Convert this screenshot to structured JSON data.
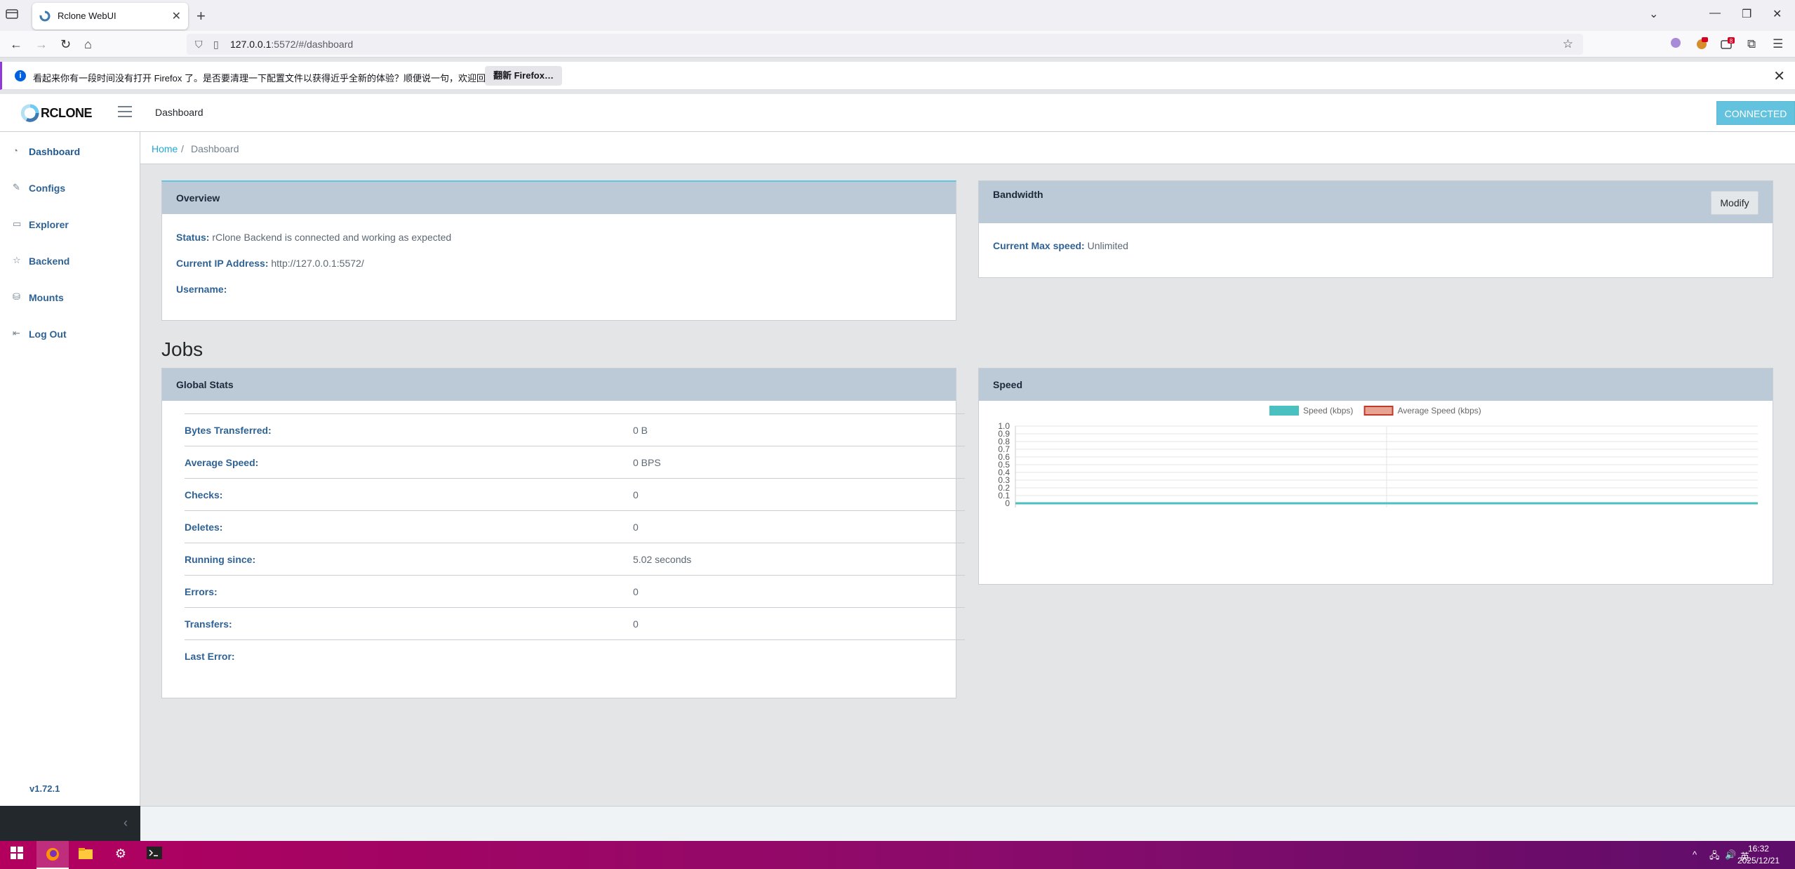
{
  "browser": {
    "tab_title": "Rclone WebUI",
    "url_host": "127.0.0.1",
    "url_rest": ":5572/#/dashboard",
    "notification_text": "看起来你有一段时间没有打开 Firefox 了。是否要清理一下配置文件以获得近乎全新的体验？顺便说一句，欢迎回来！",
    "notification_button": "翻新 Firefox…",
    "extension_badge": "8"
  },
  "header": {
    "logo_text": "RCLONE",
    "nav_dashboard": "Dashboard",
    "connected_label": "CONNECTED"
  },
  "sidebar": {
    "items": [
      {
        "label": "Dashboard",
        "icon": "speedometer-icon"
      },
      {
        "label": "Configs",
        "icon": "pencil-square-icon"
      },
      {
        "label": "Explorer",
        "icon": "monitor-icon"
      },
      {
        "label": "Backend",
        "icon": "star-icon"
      },
      {
        "label": "Mounts",
        "icon": "drive-icon"
      },
      {
        "label": "Log Out",
        "icon": "logout-icon"
      }
    ],
    "version": "v1.72.1"
  },
  "breadcrumb": {
    "home": "Home",
    "separator": "/",
    "current": "Dashboard"
  },
  "overview": {
    "title": "Overview",
    "status_label": "Status:",
    "status_value": "rClone Backend is connected and working as expected",
    "ip_label": "Current IP Address:",
    "ip_value": "http://127.0.0.1:5572/",
    "username_label": "Username:",
    "username_value": ""
  },
  "bandwidth": {
    "title": "Bandwidth",
    "modify_label": "Modify",
    "max_speed_label": "Current Max speed:",
    "max_speed_value": "Unlimited"
  },
  "jobs": {
    "title": "Jobs",
    "global_stats": {
      "title": "Global Stats",
      "rows": [
        {
          "key": "Bytes Transferred:",
          "value": "0 B"
        },
        {
          "key": "Average Speed:",
          "value": "0 BPS"
        },
        {
          "key": "Checks:",
          "value": "0"
        },
        {
          "key": "Deletes:",
          "value": "0"
        },
        {
          "key": "Running since:",
          "value": "5.02 seconds"
        },
        {
          "key": "Errors:",
          "value": "0"
        },
        {
          "key": "Transfers:",
          "value": "0"
        },
        {
          "key": "Last Error:",
          "value": ""
        }
      ]
    },
    "speed": {
      "title": "Speed"
    }
  },
  "chart_data": {
    "type": "line",
    "title": "",
    "xlabel": "",
    "ylabel": "",
    "ylim": [
      0,
      1.0
    ],
    "yticks": [
      "1.0",
      "0.9",
      "0.8",
      "0.7",
      "0.6",
      "0.5",
      "0.4",
      "0.3",
      "0.2",
      "0.1",
      "0"
    ],
    "grid": true,
    "legend_position": "top",
    "series": [
      {
        "name": "Speed (kbps)",
        "color": "#4bc0c0",
        "values": [
          0,
          0,
          0
        ]
      },
      {
        "name": "Average Speed (kbps)",
        "color": "#e8a493",
        "border": "#c0392b",
        "values": [
          0,
          0,
          0
        ]
      }
    ]
  },
  "taskbar": {
    "time": "16:32",
    "date": "2025/12/21",
    "ime": "英"
  },
  "colors": {
    "accent": "#63c2de",
    "card_header": "#bccad8",
    "label": "#2f6294",
    "taskbar_start": "#b3005f",
    "taskbar_end": "#5e0d6a"
  }
}
